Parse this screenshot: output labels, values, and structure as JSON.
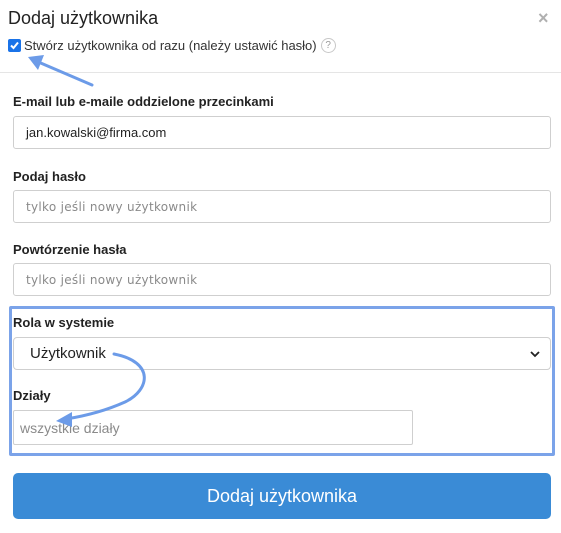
{
  "dialog": {
    "title": "Dodaj użytkownika",
    "close_label": "×"
  },
  "create_now": {
    "checked": true,
    "label": "Stwórz użytkownika od razu (należy ustawić hasło)",
    "help_label": "?"
  },
  "fields": {
    "email": {
      "label": "E-mail lub e-maile oddzielone przecinkami",
      "value": "jan.kowalski@firma.com"
    },
    "password": {
      "label": "Podaj hasło",
      "placeholder": "tylko jeśli nowy użytkownik"
    },
    "password_repeat": {
      "label": "Powtórzenie hasła",
      "placeholder": "tylko jeśli nowy użytkownik"
    },
    "role": {
      "label": "Rola w systemie",
      "selected": "Użytkownik"
    },
    "departments": {
      "label": "Działy",
      "placeholder": "wszystkie działy"
    }
  },
  "submit_label": "Dodaj użytkownika",
  "colors": {
    "accent": "#3a8bd6",
    "highlight": "#7ba3e9",
    "checkbox": "#1a73e8"
  }
}
